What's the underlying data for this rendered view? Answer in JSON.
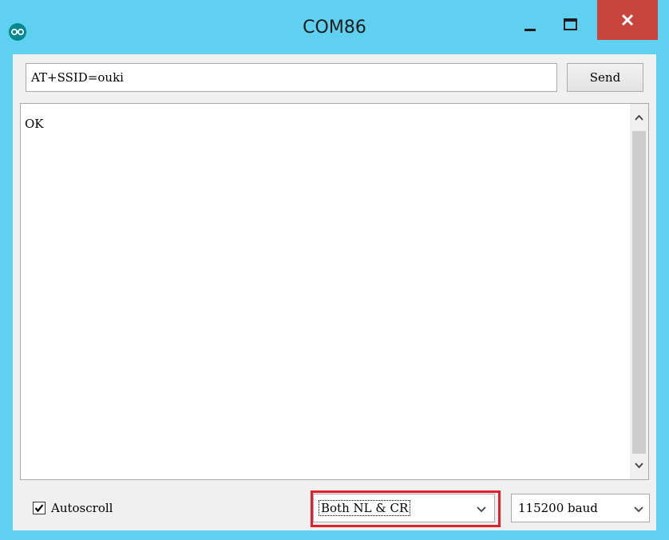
{
  "window": {
    "title": "COM86",
    "app_icon": "arduino-logo-icon",
    "colors": {
      "titlebar": "#5fd0ef",
      "close": "#c8453e",
      "highlight": "#e3202a"
    }
  },
  "input": {
    "value": "AT+SSID=ouki"
  },
  "send_button": {
    "label": "Send"
  },
  "output": {
    "text": "OK"
  },
  "autoscroll": {
    "label": "Autoscroll",
    "checked": true
  },
  "line_ending": {
    "selected": "Both NL & CR"
  },
  "baud": {
    "selected": "115200 baud"
  }
}
